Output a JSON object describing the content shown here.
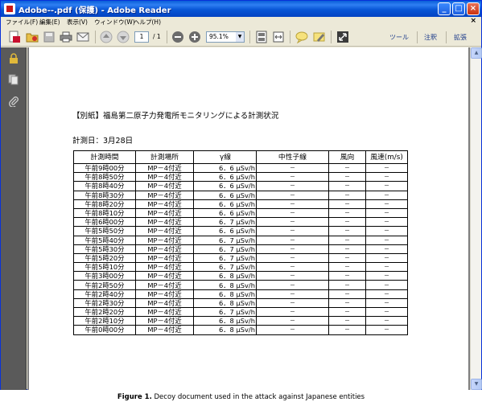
{
  "window": {
    "title": "Adobe--.pdf (保護) - Adobe Reader",
    "controls": {
      "minimize": "_",
      "maximize": "□",
      "close": "×"
    }
  },
  "menu": {
    "items": [
      "ファイル(F)",
      "編集(E)",
      "表示(V)",
      "ウィンドウ(W)",
      "ヘルプ(H)"
    ],
    "close": "×"
  },
  "toolbar": {
    "page_current": "1",
    "page_total": "/ 1",
    "zoom": "95.1%",
    "tools_label": "ツール",
    "comment_label": "注釈",
    "extend_label": "拡張"
  },
  "document": {
    "title": "【別紙】福島第二原子力発電所モニタリングによる計測状況",
    "date_line": "計測日：3月28日",
    "table": {
      "headers": [
        "計測時間",
        "計測場所",
        "γ線",
        "中性子線",
        "風向",
        "風速(m/s)"
      ],
      "rows": [
        [
          "午前9時00分",
          "MP－4付近",
          "6．6 μSv/h",
          "－",
          "－",
          "－"
        ],
        [
          "午前8時50分",
          "MP－4付近",
          "6．6 μSv/h",
          "－",
          "－",
          "－"
        ],
        [
          "午前8時40分",
          "MP－4付近",
          "6．6 μSv/h",
          "－",
          "－",
          "－"
        ],
        [
          "午前8時30分",
          "MP－4付近",
          "6．6 μSv/h",
          "－",
          "－",
          "－"
        ],
        [
          "午前8時20分",
          "MP－4付近",
          "6．6 μSv/h",
          "－",
          "－",
          "－"
        ],
        [
          "午前8時10分",
          "MP－4付近",
          "6．6 μSv/h",
          "－",
          "－",
          "－"
        ],
        [
          "午前6時00分",
          "MP－4付近",
          "6．7 μSv/h",
          "－",
          "－",
          "－"
        ],
        [
          "午前5時50分",
          "MP－4付近",
          "6．6 μSv/h",
          "－",
          "－",
          "－"
        ],
        [
          "午前5時40分",
          "MP－4付近",
          "6．7 μSv/h",
          "－",
          "－",
          "－"
        ],
        [
          "午前5時30分",
          "MP－4付近",
          "6．7 μSv/h",
          "－",
          "－",
          "－"
        ],
        [
          "午前5時20分",
          "MP－4付近",
          "6．7 μSv/h",
          "－",
          "－",
          "－"
        ],
        [
          "午前5時10分",
          "MP－4付近",
          "6．7 μSv/h",
          "－",
          "－",
          "－"
        ],
        [
          "午前3時00分",
          "MP－4付近",
          "6．8 μSv/h",
          "－",
          "－",
          "－"
        ],
        [
          "午前2時50分",
          "MP－4付近",
          "6．8 μSv/h",
          "－",
          "－",
          "－"
        ],
        [
          "午前2時40分",
          "MP－4付近",
          "6．8 μSv/h",
          "－",
          "－",
          "－"
        ],
        [
          "午前2時30分",
          "MP－4付近",
          "6．8 μSv/h",
          "－",
          "－",
          "－"
        ],
        [
          "午前2時20分",
          "MP－4付近",
          "6．7 μSv/h",
          "－",
          "－",
          "－"
        ],
        [
          "午前2時10分",
          "MP－4付近",
          "6．8 μSv/h",
          "－",
          "－",
          "－"
        ],
        [
          "午前0時00分",
          "MP－4付近",
          "6．8 μSv/h",
          "－",
          "－",
          "－"
        ]
      ]
    }
  },
  "caption": {
    "label": "Figure 1.",
    "text": " Decoy document used in the attack against Japanese entities"
  },
  "colors": {
    "titlebar": "#0856d6",
    "chrome": "#ece9d8",
    "nav_pane": "#5a5a5a",
    "doc_background": "#7f7f7f"
  }
}
